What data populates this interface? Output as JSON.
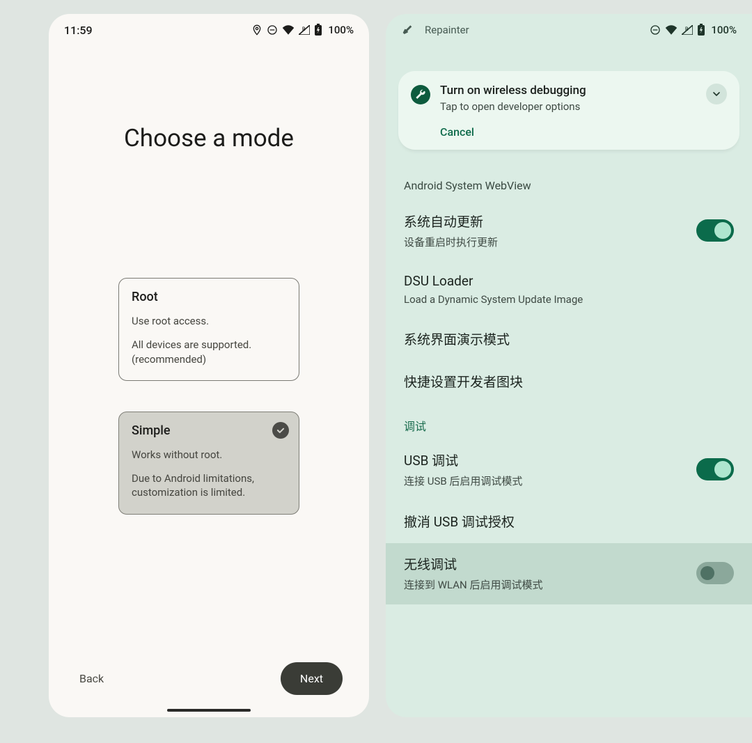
{
  "left": {
    "status": {
      "time": "11:59",
      "battery": "100%"
    },
    "title": "Choose a mode",
    "cards": [
      {
        "title": "Root",
        "line1": "Use root access.",
        "line2": "All devices are supported. (recommended)"
      },
      {
        "title": "Simple",
        "line1": "Works without root.",
        "line2": "Due to Android limitations, customization is limited."
      }
    ],
    "footer": {
      "back": "Back",
      "next": "Next"
    }
  },
  "right": {
    "status": {
      "app_name": "Repainter",
      "battery": "100%"
    },
    "banner": {
      "title": "Turn on wireless debugging",
      "subtitle": "Tap to open developer options",
      "cancel": "Cancel"
    },
    "info_line": "Android System WebView",
    "rows": {
      "r0": {
        "title": "系统自动更新",
        "sub": "设备重启时执行更新"
      },
      "r1": {
        "title": "DSU Loader",
        "sub": "Load a Dynamic System Update Image"
      },
      "r2": {
        "title": "系统界面演示模式"
      },
      "r3": {
        "title": "快捷设置开发者图块"
      }
    },
    "section": "调试",
    "debug": {
      "d0": {
        "title": "USB 调试",
        "sub": "连接 USB 后启用调试模式"
      },
      "d1": {
        "title": "撤消 USB 调试授权"
      },
      "d2": {
        "title": "无线调试",
        "sub": "连接到 WLAN 后启用调试模式"
      }
    }
  }
}
